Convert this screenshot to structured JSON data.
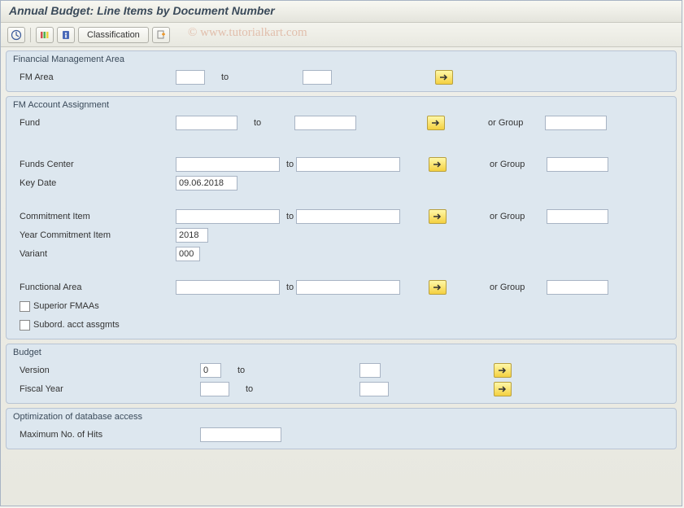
{
  "title": "Annual Budget: Line Items by Document Number",
  "toolbar": {
    "classification_label": "Classification"
  },
  "watermark": "© www.tutorialkart.com",
  "groups": {
    "fma": {
      "title": "Financial Management Area",
      "fm_area_label": "FM Area",
      "fm_area_from": "",
      "to_label": "to",
      "fm_area_to": ""
    },
    "assign": {
      "title": "FM Account Assignment",
      "fund_label": "Fund",
      "fund_from": "",
      "fund_to": "",
      "or_group_label": "or Group",
      "fund_group": "",
      "funds_center_label": "Funds Center",
      "fc_from": "",
      "fc_to": "",
      "fc_group": "",
      "key_date_label": "Key Date",
      "key_date_value": "09.06.2018",
      "commit_item_label": "Commitment Item",
      "ci_from": "",
      "ci_to": "",
      "ci_group": "",
      "year_commit_label": "Year Commitment Item",
      "year_commit_value": "2018",
      "variant_label": "Variant",
      "variant_value": "000",
      "func_area_label": "Functional Area",
      "fa_from": "",
      "fa_to": "",
      "fa_group": "",
      "superior_label": "Superior FMAAs",
      "subord_label": "Subord. acct assgmts",
      "to_label": "to"
    },
    "budget": {
      "title": "Budget",
      "version_label": "Version",
      "version_from": "0",
      "version_to": "",
      "fiscal_label": "Fiscal Year",
      "fiscal_from": "",
      "fiscal_to": "",
      "to_label": "to"
    },
    "opt": {
      "title": "Optimization of database access",
      "max_hits_label": "Maximum No. of Hits",
      "max_hits_value": ""
    }
  }
}
